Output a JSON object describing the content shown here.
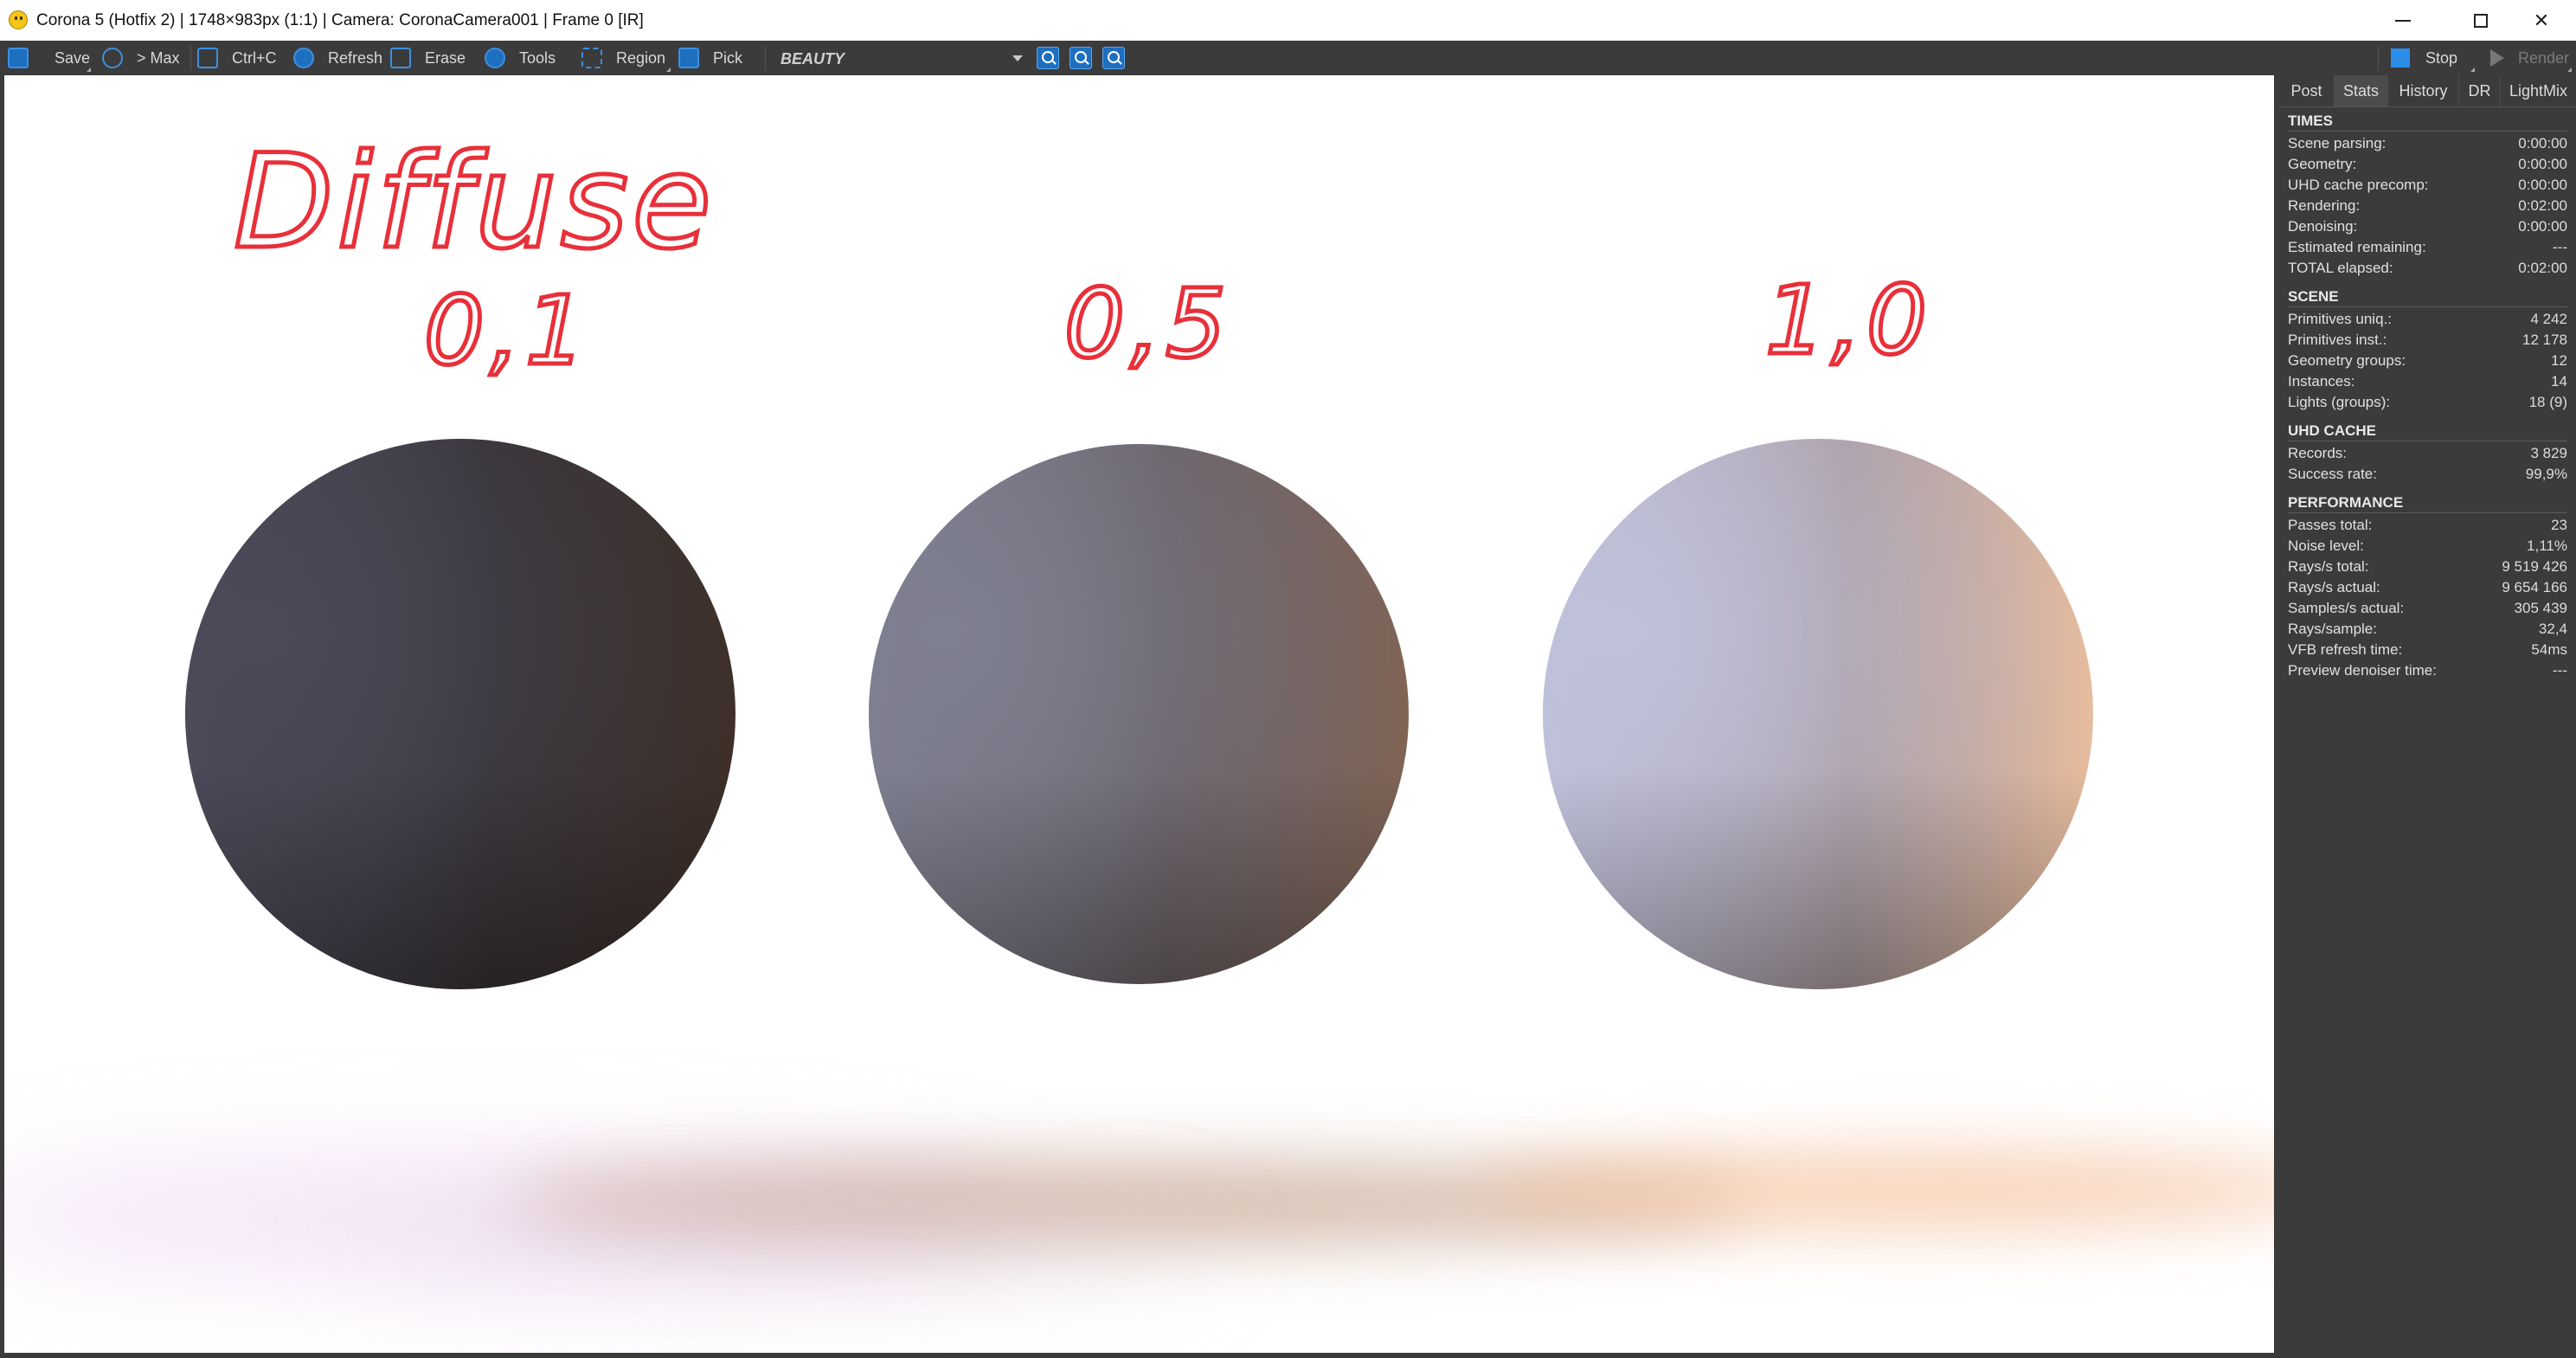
{
  "window": {
    "title": "Corona 5 (Hotfix 2) | 1748×983px (1:1) | Camera: CoronaCamera001 | Frame 0 [IR]",
    "close_glyph": "✕"
  },
  "toolbar": {
    "save": "Save",
    "max": "> Max",
    "copy": "Ctrl+C",
    "refresh": "Refresh",
    "erase": "Erase",
    "tools": "Tools",
    "region": "Region",
    "pick": "Pick",
    "channel": "BEAUTY",
    "stop": "Stop",
    "render": "Render"
  },
  "render": {
    "heading": "Diffuse",
    "labels": [
      "0,1",
      "0,5",
      "1,0"
    ],
    "spheres": [
      {
        "label": "0,1",
        "light": "#4a4a58",
        "mid": "#332c2e",
        "warm": "#3e3029"
      },
      {
        "label": "0,5",
        "light": "#7e7f90",
        "mid": "#655a5c",
        "warm": "#806456"
      },
      {
        "label": "1,0",
        "light": "#bfc0da",
        "mid": "#a59393",
        "warm": "#e7bc9e"
      }
    ],
    "annotation_color": "#e8303a"
  },
  "panel": {
    "tabs": [
      "Post",
      "Stats",
      "History",
      "DR",
      "LightMix"
    ],
    "active_tab": "Stats",
    "sections": [
      {
        "title": "TIMES",
        "rows": [
          {
            "label": "Scene parsing:",
            "value": "0:00:00"
          },
          {
            "label": "Geometry:",
            "value": "0:00:00"
          },
          {
            "label": "UHD cache precomp:",
            "value": "0:00:00"
          },
          {
            "label": "Rendering:",
            "value": "0:02:00"
          },
          {
            "label": "Denoising:",
            "value": "0:00:00"
          },
          {
            "label": "Estimated remaining:",
            "value": "---"
          },
          {
            "label": "TOTAL elapsed:",
            "value": "0:02:00"
          }
        ]
      },
      {
        "title": "SCENE",
        "rows": [
          {
            "label": "Primitives uniq.:",
            "value": "4 242"
          },
          {
            "label": "Primitives inst.:",
            "value": "12 178"
          },
          {
            "label": "Geometry groups:",
            "value": "12"
          },
          {
            "label": "Instances:",
            "value": "14"
          },
          {
            "label": "Lights (groups):",
            "value": "18 (9)"
          }
        ]
      },
      {
        "title": "UHD CACHE",
        "rows": [
          {
            "label": "Records:",
            "value": "3 829"
          },
          {
            "label": "Success rate:",
            "value": "99,9%"
          }
        ]
      },
      {
        "title": "PERFORMANCE",
        "rows": [
          {
            "label": "Passes total:",
            "value": "23"
          },
          {
            "label": "Noise level:",
            "value": "1,11%"
          },
          {
            "label": "Rays/s total:",
            "value": "9 519 426"
          },
          {
            "label": "Rays/s actual:",
            "value": "9 654 166"
          },
          {
            "label": "Samples/s actual:",
            "value": "305 439"
          },
          {
            "label": "Rays/sample:",
            "value": "32,4"
          },
          {
            "label": "VFB refresh time:",
            "value": "54ms"
          },
          {
            "label": "Preview denoiser time:",
            "value": "---"
          }
        ]
      }
    ]
  }
}
